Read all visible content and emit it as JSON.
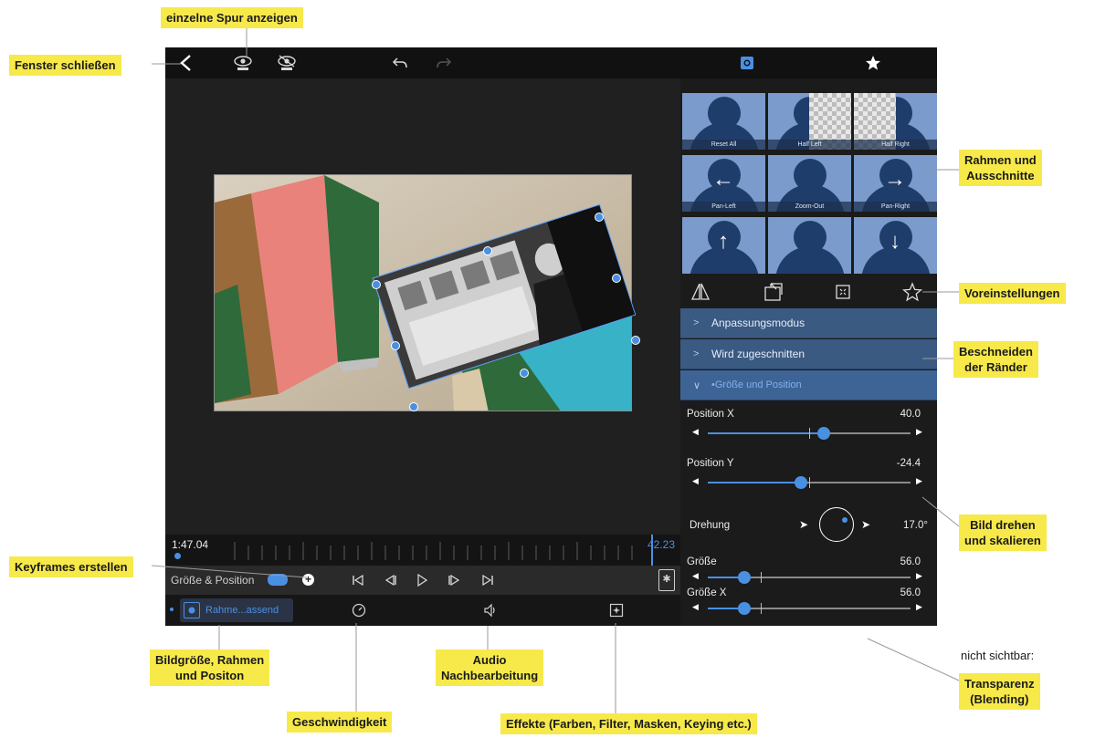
{
  "annotations": {
    "spur": "einzelne Spur anzeigen",
    "fenster": "Fenster schließen",
    "rahmen_line1": "Rahmen und",
    "rahmen_line2": "Ausschnitte",
    "voreinstellungen": "Voreinstellungen",
    "beschneiden_line1": "Beschneiden",
    "beschneiden_line2": "der Ränder",
    "drehen_line1": "Bild drehen",
    "drehen_line2": "und skalieren",
    "keyframes": "Keyframes erstellen",
    "bildgroesse_line1": "Bildgröße, Rahmen",
    "bildgroesse_line2": "und Positon",
    "audio_line1": "Audio",
    "audio_line2": "Nachbearbeitung",
    "nicht_sichtbar": "nicht sichtbar:",
    "transparenz_line1": "Transparenz",
    "transparenz_line2": "(Blending)",
    "geschwindigkeit": "Geschwindigkeit",
    "effekte": "Effekte (Farben, Filter, Masken, Keying etc.)"
  },
  "timeline": {
    "start_time": "1:47.04",
    "end_time": "42.23"
  },
  "keyframes_bar": {
    "label": "Größe & Position"
  },
  "clip": {
    "label": "Rahme...assend"
  },
  "presets": [
    {
      "label": "Reset All",
      "kind": "full"
    },
    {
      "label": "Half Left",
      "kind": "half-left"
    },
    {
      "label": "Half Right",
      "kind": "half-right"
    },
    {
      "label": "Pan-Left",
      "kind": "arrow-left"
    },
    {
      "label": "Zoom-Out",
      "kind": "full"
    },
    {
      "label": "Pan-Right",
      "kind": "arrow-right"
    },
    {
      "label": "",
      "kind": "arrow-up"
    },
    {
      "label": "",
      "kind": "full"
    },
    {
      "label": "",
      "kind": "arrow-down"
    }
  ],
  "sections": {
    "s1": "Anpassungsmodus",
    "s2": "Wird zugeschnitten",
    "s3": "•Größe und Position"
  },
  "sliders": {
    "pos_x": {
      "label": "Position X",
      "value": "40.0",
      "fraction": 0.57
    },
    "pos_y": {
      "label": "Position Y",
      "value": "-24.4",
      "fraction": 0.46
    },
    "groesse": {
      "label": "Größe",
      "value": "56.0",
      "fraction": 0.18
    },
    "groesse_x": {
      "label": "Größe X",
      "value": "56.0",
      "fraction": 0.18
    }
  },
  "rotation": {
    "label": "Drehung",
    "value": "17.0°"
  },
  "colors": {
    "accent": "#4a90e2",
    "callout": "#f7e94a",
    "section": "#3a5a82"
  }
}
